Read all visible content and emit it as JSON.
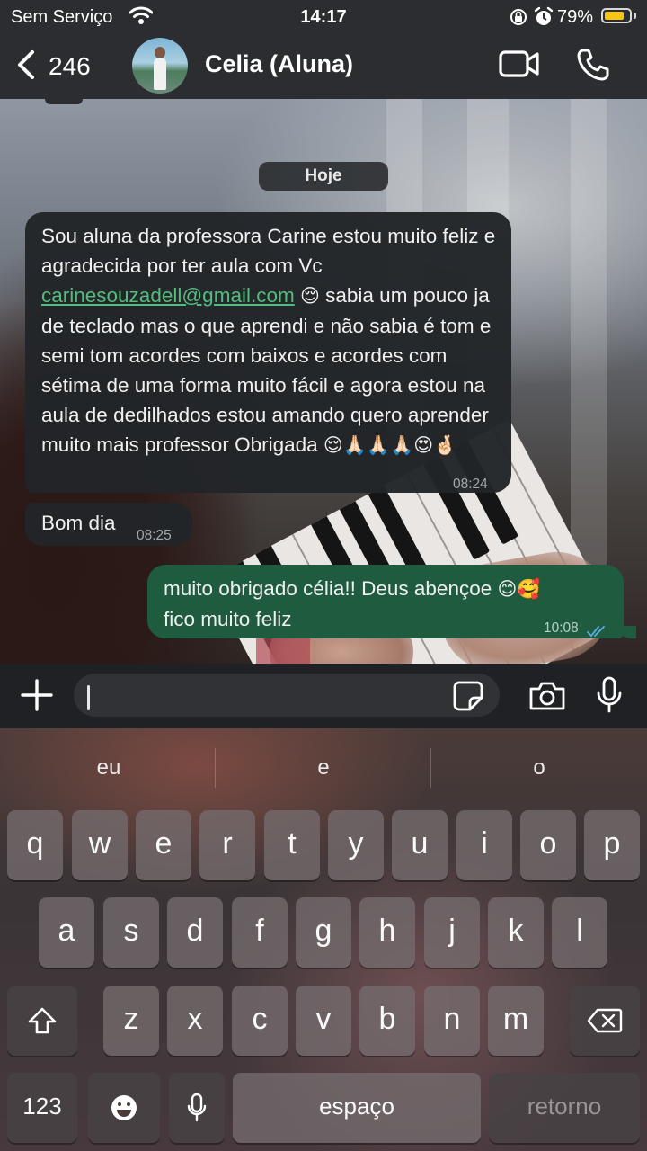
{
  "status_bar": {
    "carrier": "Sem Serviço",
    "time": "14:17",
    "battery_percent": "79%",
    "battery_level": 0.79,
    "battery_color": "#f5c518"
  },
  "header": {
    "back_count": "246",
    "contact_name": "Celia (Aluna)",
    "icons": [
      "chevron-left-icon",
      "video-call-icon",
      "phone-icon"
    ]
  },
  "chat": {
    "date_label": "Hoje",
    "messages": [
      {
        "direction": "incoming",
        "text_before_link": "Sou aluna da professora Carine estou muito feliz e agradecida por ter aula com  Vc ",
        "link": "carinesouzadell@gmail.com",
        "emoji_after_link": "😌",
        "text_after_link": " sabia um pouco ja de teclado mas o que aprendi e não sabia é tom e semi tom acordes com baixos e acordes com sétima de uma forma muito fácil e agora estou na aula de dedilhados estou amando quero aprender muito mais professor Obrigada ",
        "emoji_end": "😌🙏🏻🙏🏻🙏🏻😍🤞🏻",
        "time": "08:24"
      },
      {
        "direction": "incoming",
        "text": "Bom dia",
        "time": "08:25"
      },
      {
        "direction": "outgoing",
        "text": "muito obrigado célia!! Deus abençoe ",
        "emoji": "😊🥰",
        "text2": "fico muito feliz",
        "time": "10:08",
        "status": "read"
      }
    ],
    "outgoing_color": "#1f5c3f",
    "link_color": "#53bd7e",
    "read_tick_color": "#5ab0e6"
  },
  "composer": {
    "input_value": "",
    "icons": [
      "plus-icon",
      "sticker-icon",
      "camera-icon",
      "microphone-icon"
    ]
  },
  "keyboard": {
    "suggestions": [
      "eu",
      "e",
      "o"
    ],
    "row1": [
      "q",
      "w",
      "e",
      "r",
      "t",
      "y",
      "u",
      "i",
      "o",
      "p"
    ],
    "row2": [
      "a",
      "s",
      "d",
      "f",
      "g",
      "h",
      "j",
      "k",
      "l"
    ],
    "row3": [
      "z",
      "x",
      "c",
      "v",
      "b",
      "n",
      "m"
    ],
    "numbers_key": "123",
    "space_key": "espaço",
    "return_key": "retorno"
  }
}
